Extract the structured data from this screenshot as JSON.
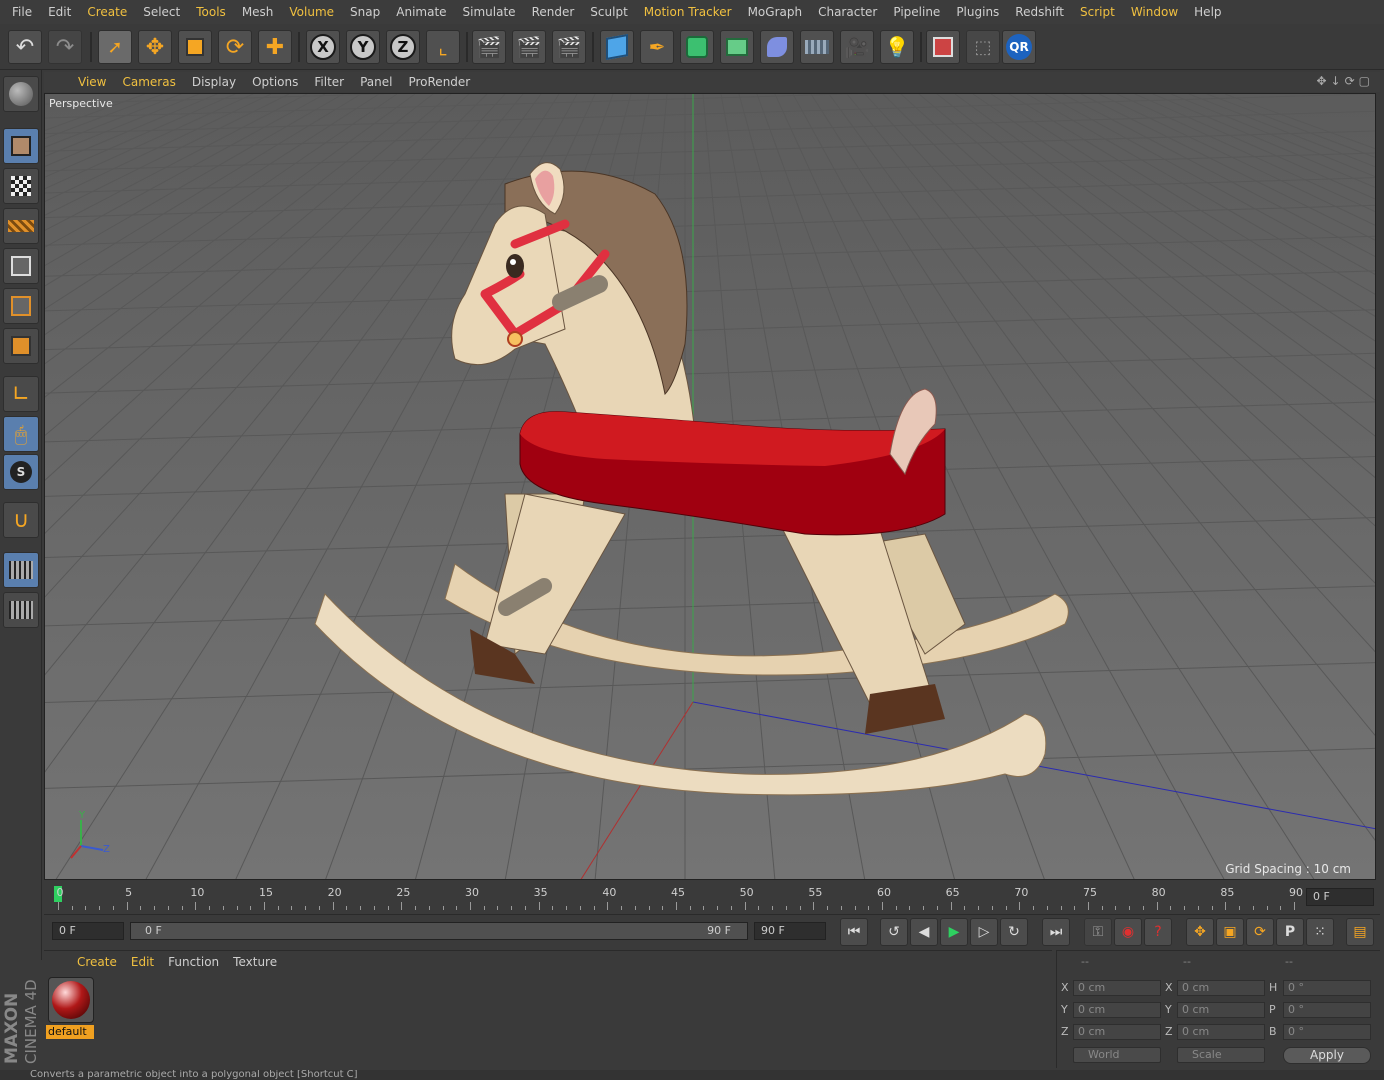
{
  "menu": [
    "File",
    "Edit",
    "Create",
    "Select",
    "Tools",
    "Mesh",
    "Volume",
    "Snap",
    "Animate",
    "Simulate",
    "Render",
    "Sculpt",
    "Motion Tracker",
    "MoGraph",
    "Character",
    "Pipeline",
    "Plugins",
    "Redshift",
    "Script",
    "Window",
    "Help"
  ],
  "toolbar": {
    "x_label": "X",
    "y_label": "Y",
    "z_label": "Z",
    "qr_label": "QR"
  },
  "viewport": {
    "menu": [
      "View",
      "Cameras",
      "Display",
      "Options",
      "Filter",
      "Panel",
      "ProRender"
    ],
    "camera": "Perspective",
    "grid_spacing": "Grid Spacing : 10 cm",
    "axis_y": "Y",
    "axis_z": "Z"
  },
  "timeline": {
    "ticks": [
      "0",
      "5",
      "10",
      "15",
      "20",
      "25",
      "30",
      "35",
      "40",
      "45",
      "50",
      "55",
      "60",
      "65",
      "70",
      "75",
      "80",
      "85",
      "90"
    ],
    "current_frame": "0 F"
  },
  "playback": {
    "start": "0 F",
    "slider_left": "0 F",
    "slider_right": "90 F",
    "end": "90 F"
  },
  "materials": {
    "menu": [
      "Create",
      "Edit",
      "Function",
      "Texture"
    ],
    "items": [
      {
        "name": "default"
      }
    ]
  },
  "coordinates": {
    "headers": [
      "--",
      "--",
      "--"
    ],
    "rows": [
      {
        "a": "X",
        "av": "0 cm",
        "b": "X",
        "bv": "0 cm",
        "c": "H",
        "cv": "0 °"
      },
      {
        "a": "Y",
        "av": "0 cm",
        "b": "Y",
        "bv": "0 cm",
        "c": "P",
        "cv": "0 °"
      },
      {
        "a": "Z",
        "av": "0 cm",
        "b": "Z",
        "bv": "0 cm",
        "c": "B",
        "cv": "0 °"
      }
    ],
    "mode": "World",
    "transform": "Scale",
    "apply": "Apply"
  },
  "logo": {
    "maxon": "MAXON",
    "product": "CINEMA 4D"
  },
  "status": "Converts a parametric object into a polygonal object [Shortcut C]",
  "colors": {
    "accent": "#f0c040",
    "viewport_bg": "#6b6b6b",
    "saddle": "#b00010",
    "wood": "#e6d2b0"
  }
}
